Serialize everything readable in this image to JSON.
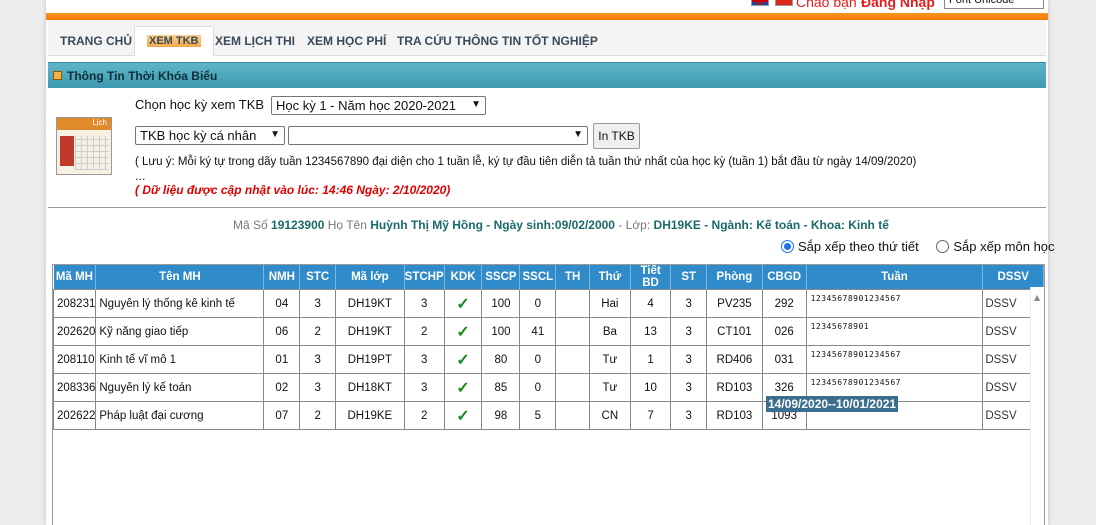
{
  "header": {
    "greeting": "Chào bạn",
    "login": "Đăng Nhập",
    "font_select": "Font Unicode"
  },
  "nav": {
    "tabs": [
      {
        "label": "TRANG CHỦ"
      },
      {
        "label": "XEM TKB"
      },
      {
        "label": "XEM LỊCH THI"
      },
      {
        "label": "XEM HỌC PHÍ"
      },
      {
        "label": "TRA CỨU THÔNG TIN TỐT NGHIỆP"
      }
    ],
    "active": "XEM TKB"
  },
  "section": {
    "title": "Thông Tin Thời Khóa Biểu",
    "icon_label": "Lịch"
  },
  "form": {
    "choose_label": "Chọn học kỳ xem TKB",
    "semester_value": "Học kỳ 1 - Năm học 2020-2021",
    "tkb_type_value": "TKB học kỳ cá nhân",
    "second_select_value": "",
    "print_button": "In TKB",
    "note": "( Lưu ý: Mỗi ký tự trong dãy tuần 1234567890 đại diện cho 1 tuần lễ, ký tự đầu tiên diễn tả tuần thứ nhất của học kỳ (tuần 1) bắt đầu từ ngày 14/09/2020)",
    "dots": "...",
    "updated": "( Dữ liệu được cập nhật vào lúc: 14:46 Ngày: 2/10/2020)"
  },
  "student": {
    "id_label": "Mã Số",
    "id": "19123900",
    "name_label": "Họ Tên",
    "name": "Huỳnh Thị Mỹ Hồng - Ngày sinh:09/02/2000",
    "class_label": "- Lớp:",
    "class_info": "DH19KE - Ngành: Kế toán - Khoa: Kinh tế"
  },
  "sort": {
    "by_day": "Sắp xếp theo thứ tiết",
    "by_subject": "Sắp xếp môn học",
    "selected": "by_day"
  },
  "table": {
    "headers": [
      "Mã MH",
      "Tên MH",
      "NMH",
      "STC",
      "Mã lớp",
      "STCHP",
      "KDK",
      "SSCP",
      "SSCL",
      "TH",
      "Thứ",
      "Tiết BD",
      "ST",
      "Phòng",
      "CBGD",
      "Tuần",
      "DSSV"
    ],
    "rows": [
      {
        "ma_mh": "208231",
        "ten_mh": "Nguyên lý thống kê kinh tế",
        "nmh": "04",
        "stc": "3",
        "ma_lop": "DH19KT",
        "stchp": "3",
        "kdk": "✓",
        "sscp": "100",
        "sscl": "0",
        "th": "",
        "thu": "Hai",
        "tiet_bd": "4",
        "st": "3",
        "phong": "PV235",
        "cbgd": "292",
        "tuan": "1234567890123456­7",
        "dssv": "DSSV"
      },
      {
        "ma_mh": "202620",
        "ten_mh": "Kỹ năng giao tiếp",
        "nmh": "06",
        "stc": "2",
        "ma_lop": "DH19KT",
        "stchp": "2",
        "kdk": "✓",
        "sscp": "100",
        "sscl": "41",
        "th": "",
        "thu": "Ba",
        "tiet_bd": "13",
        "st": "3",
        "phong": "CT101",
        "cbgd": "026",
        "tuan": "12345678901",
        "dssv": "DSSV"
      },
      {
        "ma_mh": "208110",
        "ten_mh": "Kinh tế vĩ mô 1",
        "nmh": "01",
        "stc": "3",
        "ma_lop": "DH19PT",
        "stchp": "3",
        "kdk": "✓",
        "sscp": "80",
        "sscl": "0",
        "th": "",
        "thu": "Tư",
        "tiet_bd": "1",
        "st": "3",
        "phong": "RD406",
        "cbgd": "031",
        "tuan": "12345678901234567",
        "dssv": "DSSV"
      },
      {
        "ma_mh": "208336",
        "ten_mh": "Nguyên lý kế toán",
        "nmh": "02",
        "stc": "3",
        "ma_lop": "DH18KT",
        "stchp": "3",
        "kdk": "✓",
        "sscp": "85",
        "sscl": "0",
        "th": "",
        "thu": "Tư",
        "tiet_bd": "10",
        "st": "3",
        "phong": "RD103",
        "cbgd": "326",
        "tuan": "12345678901234567",
        "dssv": "DSSV"
      },
      {
        "ma_mh": "202622",
        "ten_mh": "Pháp luật đại cương",
        "nmh": "07",
        "stc": "2",
        "ma_lop": "DH19KE",
        "stchp": "2",
        "kdk": "✓",
        "sscp": "98",
        "sscl": "5",
        "th": "",
        "thu": "CN",
        "tiet_bd": "7",
        "st": "3",
        "phong": "RD103",
        "cbgd": "1093",
        "tuan": "",
        "dssv": "DSSV"
      }
    ]
  },
  "tooltip": "14/09/2020--10/01/2021"
}
